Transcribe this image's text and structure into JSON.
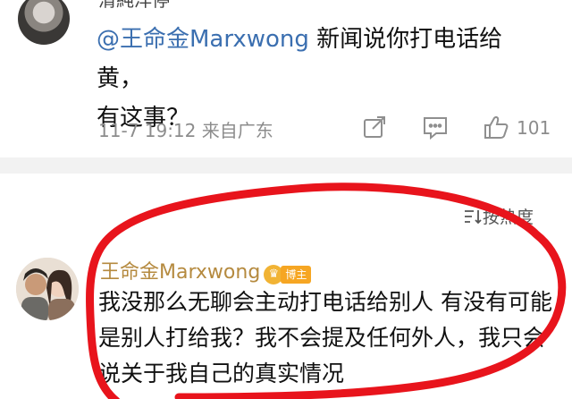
{
  "comment1": {
    "username": "清純洋停",
    "mention": "@王命金Marxwong",
    "text_line1_rest": " 新闻说你打电话给黄，",
    "text_line2": "有这事？",
    "meta": "11-7 19:12 来自广东",
    "likes": "101"
  },
  "sort": {
    "label": "按热度"
  },
  "comment2": {
    "username": "王命金Marxwong",
    "badge": "博主",
    "text": "我没那么无聊会主动打电话给别人 有没有可能是别人打给我？我不会提及任何外人，我只会说关于我自己的真实情况"
  },
  "colors": {
    "mention": "#3b6fb0",
    "name_gold": "#b58a3f",
    "badge_orange": "#f6a623",
    "annotation_red": "#e8141c",
    "meta_gray": "#8c8c8c"
  },
  "icons": [
    "share-icon",
    "comment-icon",
    "like-icon",
    "sort-icon",
    "crown-icon"
  ]
}
